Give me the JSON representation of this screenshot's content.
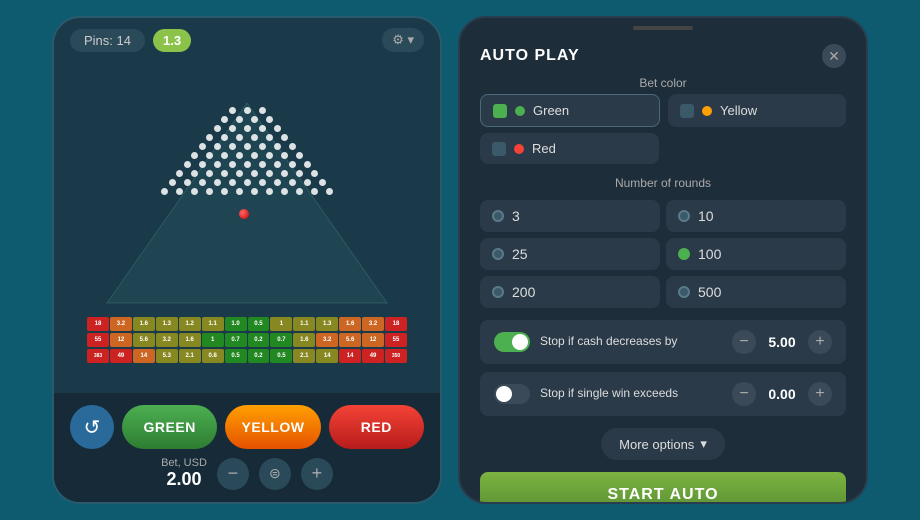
{
  "left_phone": {
    "pins_label": "Pins: 14",
    "multiplier": "1.3",
    "settings_label": "⚙ ▾",
    "color_buttons": [
      "GREEN",
      "YELLOW",
      "RED"
    ],
    "bet_label": "Bet, USD",
    "bet_amount": "2.00"
  },
  "right_panel": {
    "title": "AUTO PLAY",
    "close_icon": "✕",
    "bet_color_label": "Bet color",
    "colors": [
      {
        "name": "Green",
        "dot": "green",
        "checked": true
      },
      {
        "name": "Yellow",
        "dot": "yellow",
        "checked": false
      },
      {
        "name": "Red",
        "dot": "red",
        "checked": false
      }
    ],
    "rounds_label": "Number of rounds",
    "rounds": [
      "3",
      "10",
      "25",
      "100",
      "200",
      "500"
    ],
    "selected_round": "100",
    "stop_cash": {
      "label": "Stop if cash decreases by",
      "value": "5.00",
      "enabled": true
    },
    "stop_win": {
      "label": "Stop if single win exceeds",
      "value": "0.00",
      "enabled": false
    },
    "more_options": "More options",
    "start_button": "START AUTO"
  },
  "dots_rows": [
    3,
    4,
    5,
    6,
    7,
    8,
    9,
    10,
    11,
    12,
    13,
    14
  ]
}
